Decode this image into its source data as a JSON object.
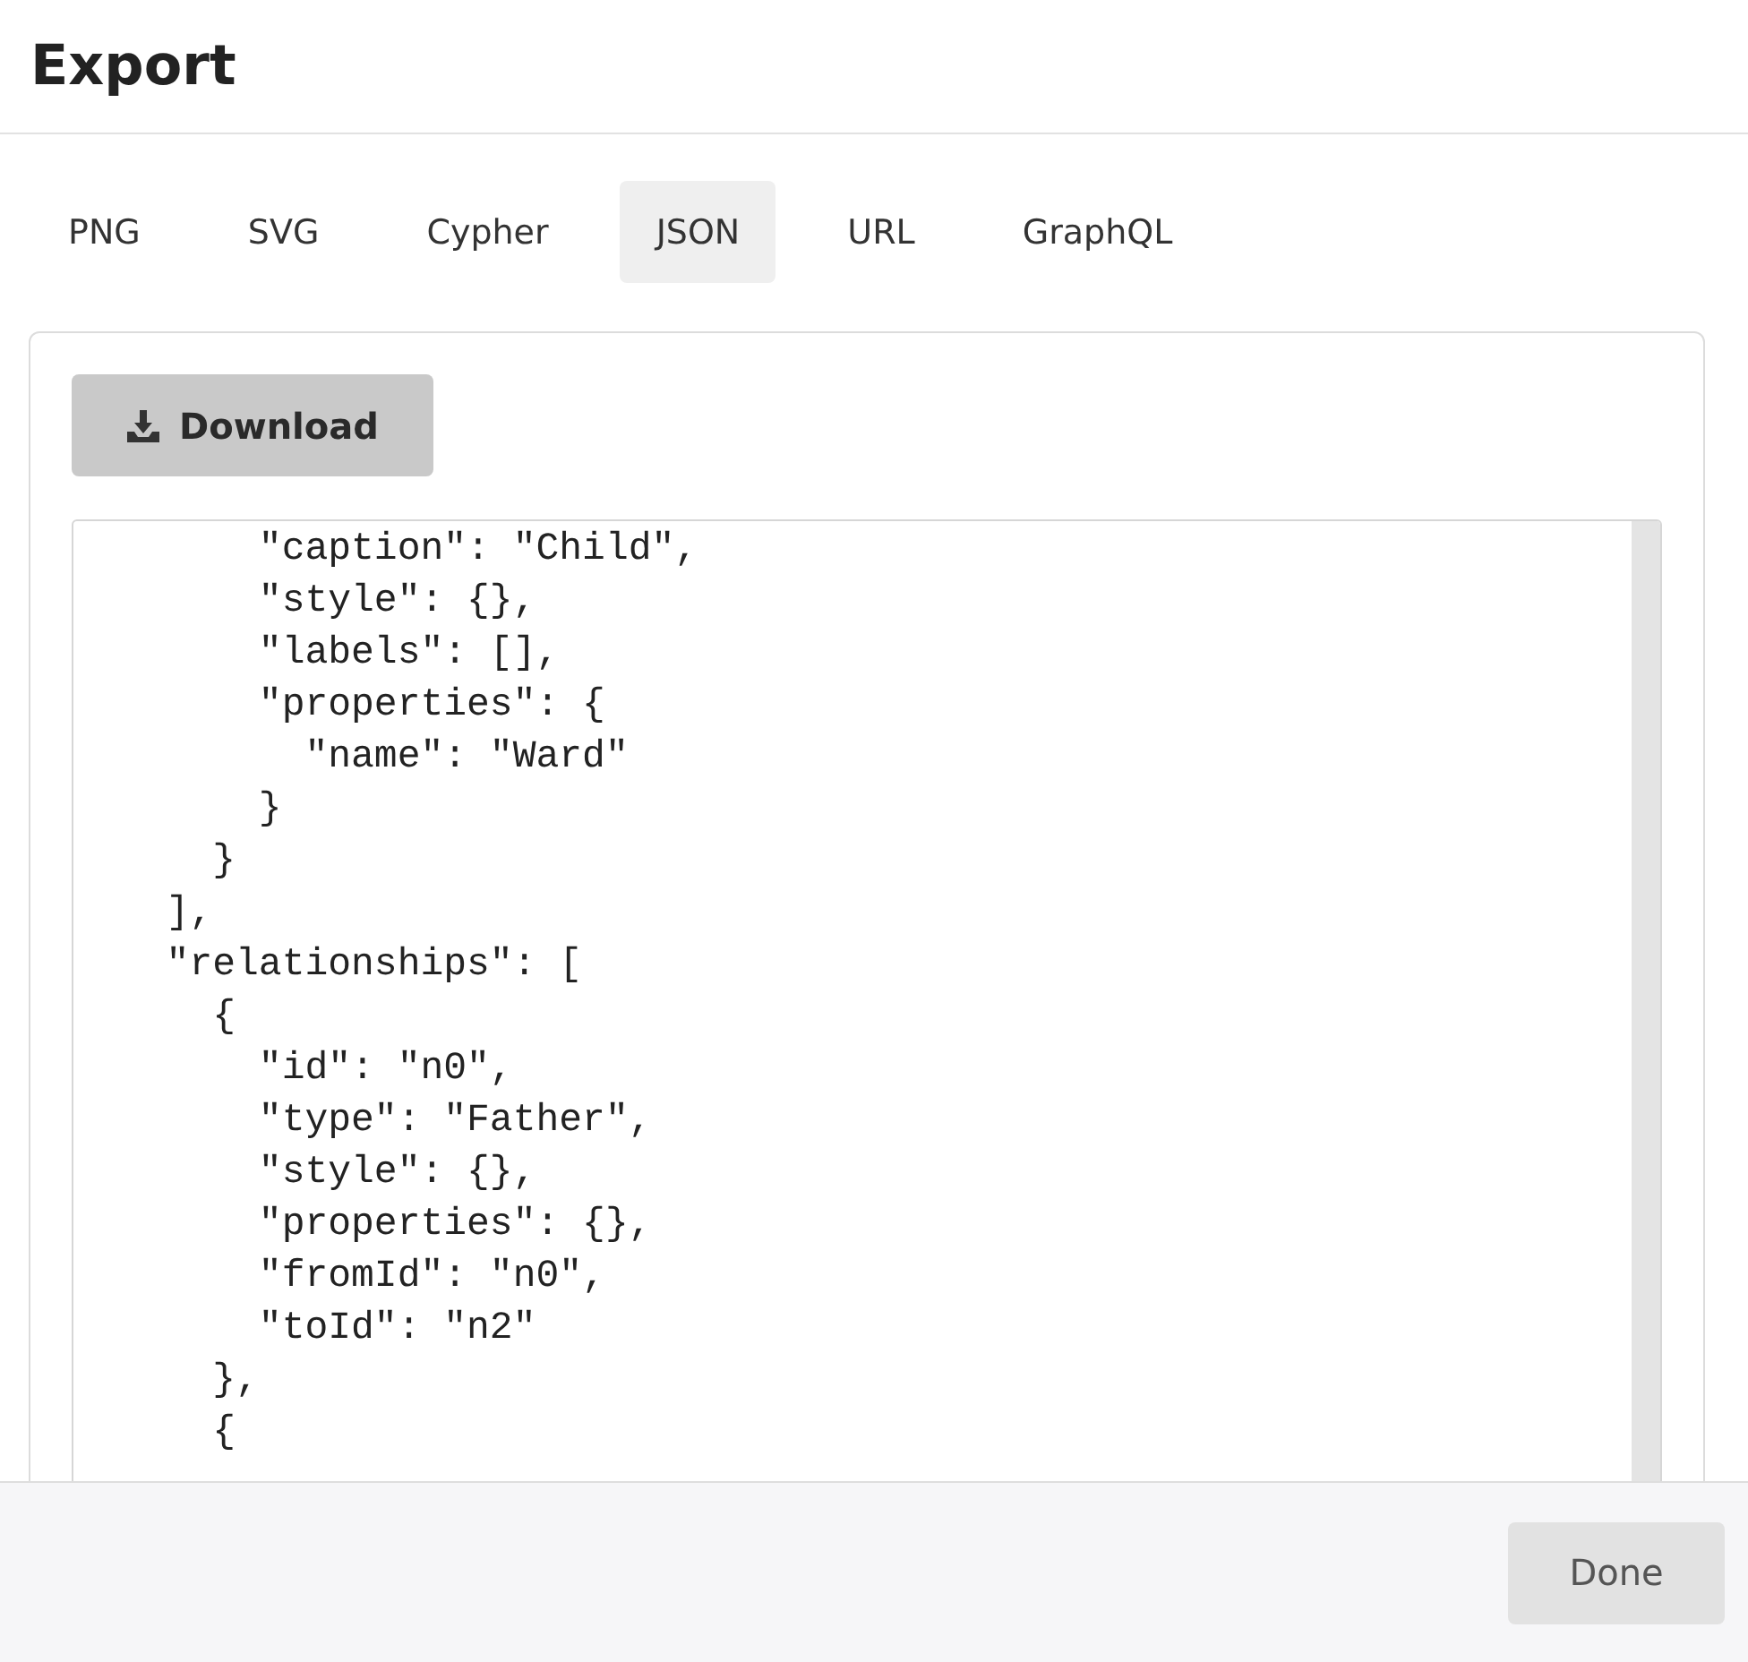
{
  "dialog": {
    "title": "Export"
  },
  "tabs": [
    {
      "label": "PNG",
      "selected": false
    },
    {
      "label": "SVG",
      "selected": false
    },
    {
      "label": "Cypher",
      "selected": false
    },
    {
      "label": "JSON",
      "selected": true
    },
    {
      "label": "URL",
      "selected": false
    },
    {
      "label": "GraphQL",
      "selected": false
    }
  ],
  "download_button": {
    "label": "Download"
  },
  "code_lines": [
    "      \"caption\": \"Child\",",
    "      \"style\": {},",
    "      \"labels\": [],",
    "      \"properties\": {",
    "        \"name\": \"Ward\"",
    "      }",
    "    }",
    "  ],",
    "  \"relationships\": [",
    "    {",
    "      \"id\": \"n0\",",
    "      \"type\": \"Father\",",
    "      \"style\": {},",
    "      \"properties\": {},",
    "      \"fromId\": \"n0\",",
    "      \"toId\": \"n2\"",
    "    },",
    "    {"
  ],
  "done_button": {
    "label": "Done"
  }
}
